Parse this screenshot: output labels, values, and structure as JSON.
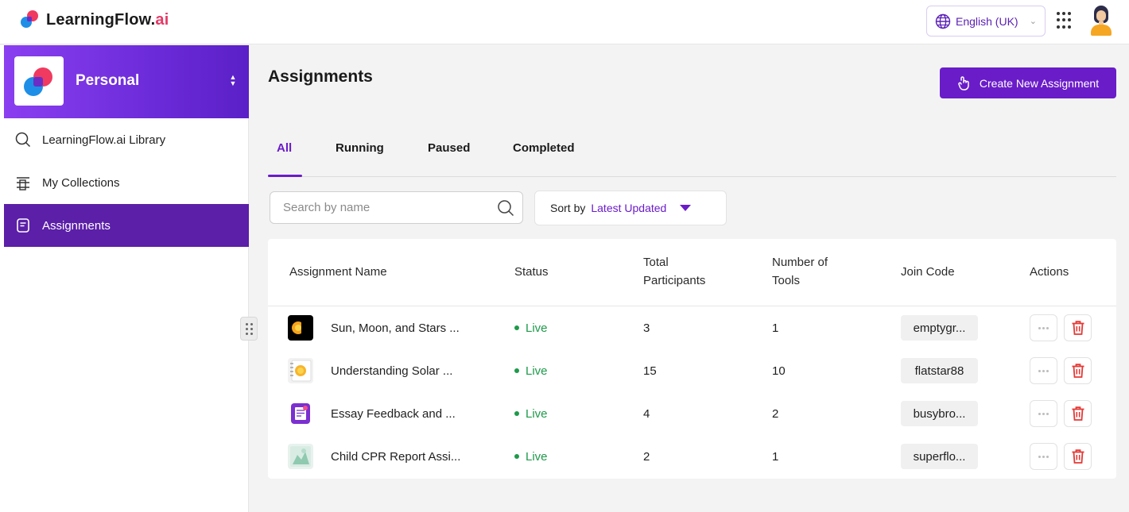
{
  "header": {
    "brand_main": "LearningFlow.",
    "brand_accent": "ai",
    "language": "English (UK)",
    "language_icon": "globe-icon",
    "apps_icon": "grid-dots-icon",
    "avatar_icon": "user-avatar"
  },
  "sidebar": {
    "workspace_name": "Personal",
    "items": [
      {
        "label": "LearningFlow.ai Library",
        "icon": "search-icon",
        "active": false
      },
      {
        "label": "My Collections",
        "icon": "collections-icon",
        "active": false
      },
      {
        "label": "Assignments",
        "icon": "assignment-icon",
        "active": true
      }
    ]
  },
  "main": {
    "title": "Assignments",
    "create_button": "Create New Assignment",
    "tabs": [
      {
        "label": "All",
        "active": true
      },
      {
        "label": "Running",
        "active": false
      },
      {
        "label": "Paused",
        "active": false
      },
      {
        "label": "Completed",
        "active": false
      }
    ],
    "search_placeholder": "Search by name",
    "sort_label": "Sort by",
    "sort_value": "Latest Updated"
  },
  "table": {
    "headers": {
      "name": "Assignment Name",
      "status": "Status",
      "participants_line1": "Total",
      "participants_line2": "Participants",
      "tools_line1": "Number of",
      "tools_line2": "Tools",
      "join_code": "Join Code",
      "actions": "Actions"
    },
    "rows": [
      {
        "name": "Sun, Moon, and Stars ...",
        "status": "Live",
        "participants": "3",
        "tools": "1",
        "code": "emptygr...",
        "thumb": "sun-moon-thumbnail"
      },
      {
        "name": "Understanding Solar ...",
        "status": "Live",
        "participants": "15",
        "tools": "10",
        "code": "flatstar88",
        "thumb": "solar-notebook-thumbnail"
      },
      {
        "name": "Essay Feedback and ...",
        "status": "Live",
        "participants": "4",
        "tools": "2",
        "code": "busybro...",
        "thumb": "essay-feedback-thumbnail"
      },
      {
        "name": "Child CPR Report Assi...",
        "status": "Live",
        "participants": "2",
        "tools": "1",
        "code": "superflo...",
        "thumb": "cpr-report-thumbnail"
      }
    ]
  },
  "colors": {
    "accent": "#6a1cc9",
    "sidebar_active": "#5b1fa8",
    "live": "#1e9a4a",
    "delete": "#e53935"
  }
}
